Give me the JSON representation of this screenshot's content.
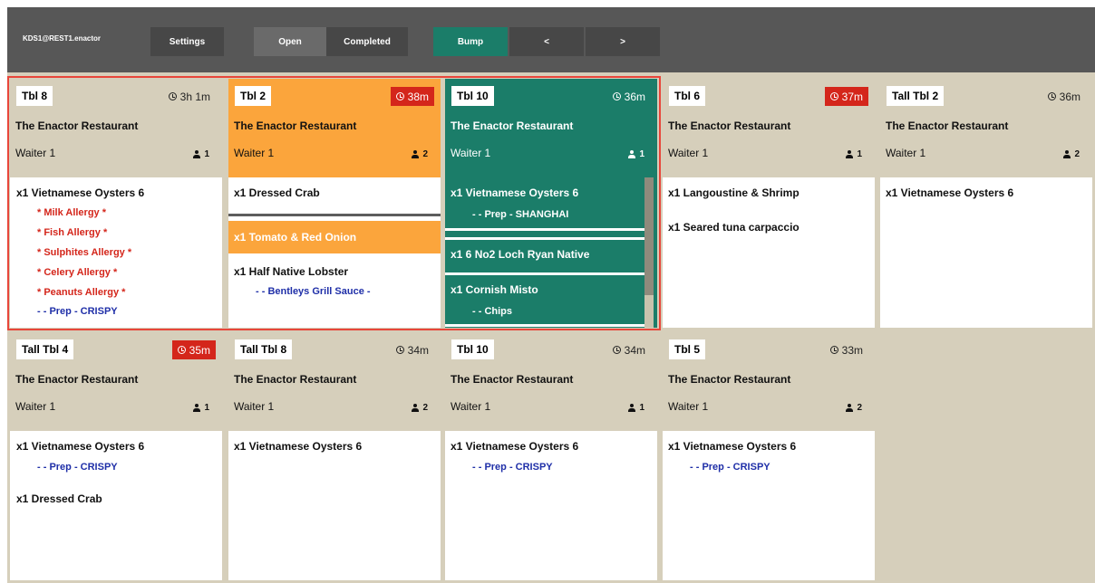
{
  "topbar": {
    "device": "KDS1@REST1.enactor",
    "settings": "Settings",
    "open": "Open",
    "completed": "Completed",
    "bump": "Bump",
    "prev": "<",
    "next": ">",
    "colors": {
      "bar": "#575757",
      "button": "#474747",
      "active": "#6a6a6a",
      "bump": "#1b7d69"
    }
  },
  "restaurant": "The Enactor Restaurant",
  "cards": [
    {
      "table": "Tbl 8",
      "timer": "3h 1m",
      "waiter": "Waiter 1",
      "guests": "1",
      "item1": "x1  Vietnamese Oysters 6",
      "mods": [
        "* Milk Allergy *",
        "* Fish Allergy  *",
        "* Sulphites Allergy *",
        "* Celery Allergy *",
        "* Peanuts Allergy *"
      ],
      "prep": "- - Prep - CRISPY"
    },
    {
      "table": "Tbl 2",
      "timer": "38m",
      "waiter": "Waiter 1",
      "guests": "2",
      "item1": "x1  Dressed Crab",
      "item2": "x1  Tomato & Red Onion",
      "item3": "x1  Half Native Lobster",
      "prep": "- - Bentleys Grill Sauce -"
    },
    {
      "table": "Tbl 10",
      "timer": "36m",
      "waiter": "Waiter 1",
      "guests": "1",
      "item1": "x1  Vietnamese Oysters 6",
      "prep": "- - Prep - SHANGHAI",
      "item2": "x1  6 No2 Loch Ryan Native",
      "item3": "x1  Cornish Misto",
      "prep2": "- - Chips"
    },
    {
      "table": "Tbl 6",
      "timer": "37m",
      "waiter": "Waiter 1",
      "guests": "1",
      "item1": "x1  Langoustine & Shrimp",
      "item2": "x1  Seared tuna carpaccio"
    },
    {
      "table": "Tall Tbl 2",
      "timer": "36m",
      "waiter": "Waiter 1",
      "guests": "2",
      "item1": "x1  Vietnamese Oysters 6"
    },
    {
      "table": "Tall Tbl 4",
      "timer": "35m",
      "waiter": "Waiter 1",
      "guests": "1",
      "item1": "x1  Vietnamese Oysters 6",
      "prep": "- - Prep - CRISPY",
      "item2": "x1  Dressed Crab"
    },
    {
      "table": "Tall Tbl 8",
      "timer": "34m",
      "waiter": "Waiter 1",
      "guests": "2",
      "item1": "x1  Vietnamese Oysters 6"
    },
    {
      "table": "Tbl 10",
      "timer": "34m",
      "waiter": "Waiter 1",
      "guests": "1",
      "item1": "x1  Vietnamese Oysters 6",
      "prep": "- - Prep - CRISPY"
    },
    {
      "table": "Tbl 5",
      "timer": "33m",
      "waiter": "Waiter 1",
      "guests": "2",
      "item1": "x1  Vietnamese Oysters 6",
      "prep": "- - Prep - CRISPY"
    }
  ],
  "colors": {
    "header": "#d6cfbb",
    "late": "#d4261b",
    "orange": "#fba53c",
    "green": "#1b7d69",
    "allergy": "#d4261b",
    "prep": "#1f2fa8"
  }
}
